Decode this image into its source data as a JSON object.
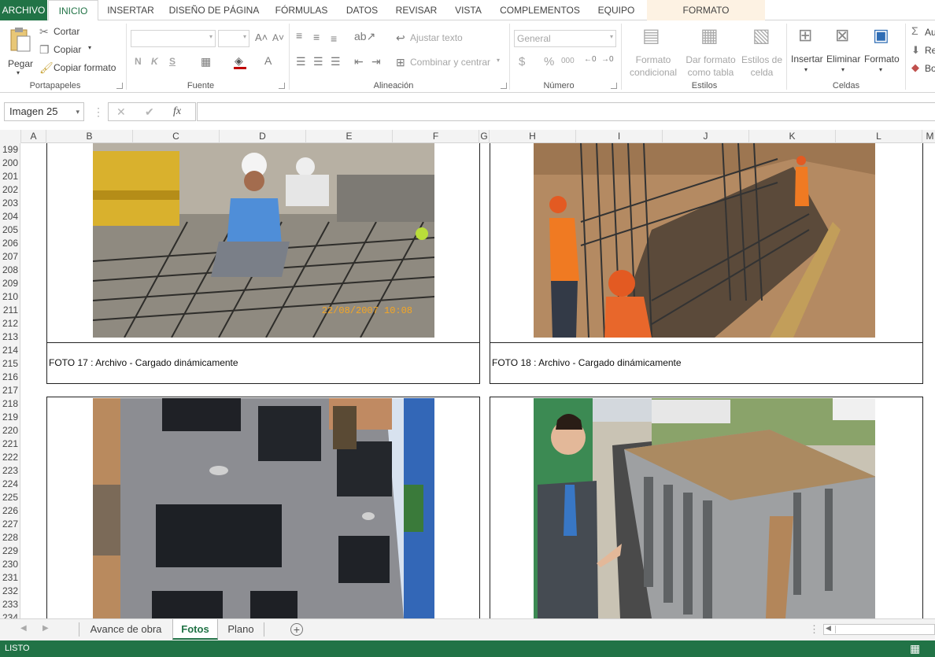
{
  "menu": {
    "file": "ARCHIVO",
    "tabs": [
      "INICIO",
      "INSERTAR",
      "DISEÑO DE PÁGINA",
      "FÓRMULAS",
      "DATOS",
      "REVISAR",
      "VISTA",
      "COMPLEMENTOS",
      "EQUIPO"
    ],
    "context_tab": "FORMATO"
  },
  "ribbon": {
    "clipboard": {
      "paste": "Pegar",
      "cut": "Cortar",
      "copy": "Copiar",
      "format_painter": "Copiar formato",
      "label": "Portapapeles"
    },
    "font": {
      "bold": "N",
      "italic": "K",
      "underline": "S",
      "label": "Fuente"
    },
    "alignment": {
      "wrap": "Ajustar texto",
      "merge": "Combinar y centrar",
      "label": "Alineación"
    },
    "number": {
      "format": "General",
      "currency": "$",
      "percent": "%",
      "thousands": "000",
      "label": "Número"
    },
    "styles": {
      "conditional": "Formato condicional",
      "as_table": "Dar formato como tabla",
      "cell_styles": "Estilos de celda",
      "label": "Estilos"
    },
    "cells": {
      "insert": "Insertar",
      "delete": "Eliminar",
      "format": "Formato",
      "label": "Celdas"
    },
    "editing": {
      "autosum": "Au",
      "fill": "Re",
      "clear": "Bo"
    }
  },
  "formula_bar": {
    "name_box": "Imagen 25",
    "fx": "fx",
    "cancel": "✕",
    "enter": "✔",
    "value": ""
  },
  "columns": [
    "A",
    "B",
    "C",
    "D",
    "E",
    "F",
    "G",
    "H",
    "I",
    "J",
    "K",
    "L",
    "M"
  ],
  "rows": [
    "199",
    "200",
    "201",
    "202",
    "203",
    "204",
    "205",
    "206",
    "207",
    "208",
    "209",
    "210",
    "211",
    "212",
    "213",
    "214",
    "215",
    "216",
    "217",
    "218",
    "219",
    "220",
    "221",
    "222",
    "223",
    "224",
    "225",
    "226",
    "227",
    "228",
    "229",
    "230",
    "231",
    "232",
    "233",
    "234"
  ],
  "photos": {
    "photo17": {
      "caption": "FOTO 17 : Archivo - Cargado dinámicamente",
      "timestamp": "22/08/2007 10:08"
    },
    "photo18": {
      "caption": "FOTO 18 : Archivo - Cargado dinámicamente"
    }
  },
  "sheet_tabs": [
    "Avance de obra",
    "Fotos",
    "Plano"
  ],
  "active_sheet": "Fotos",
  "status": "LISTO",
  "colors": {
    "accent": "#217346"
  }
}
